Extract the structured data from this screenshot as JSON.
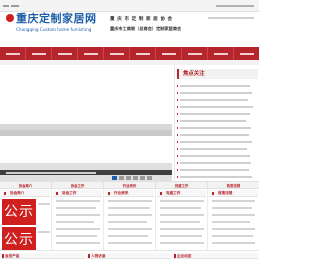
{
  "header": {
    "logo_cn": "重庆定制家居网",
    "logo_en": "Chongqing Custom home furnishing",
    "assoc_cn": "重庆市定制家居协会",
    "assoc_sub": "重庆市工商联（总商会）定制家居商会"
  },
  "news": {
    "title": "焦点关注"
  },
  "categories": [
    "协会简介",
    "协会工作",
    "行业资讯",
    "党建工作",
    "政策法规"
  ],
  "columns": {
    "col1": {
      "label": "协会简介",
      "badge": "公示"
    },
    "col2": {
      "label": "协会工作"
    },
    "col3": {
      "label": "行业资讯"
    },
    "col4": {
      "label": "党建工作"
    },
    "col5": {
      "label": "政策法规"
    }
  },
  "bottom": {
    "b1": "会员产品",
    "b2": "人物访谈",
    "b3": "企业动态"
  },
  "colors": {
    "brand_red": "#b5252b",
    "brand_blue": "#1d5ea8",
    "badge_red": "#cf1f1f"
  }
}
